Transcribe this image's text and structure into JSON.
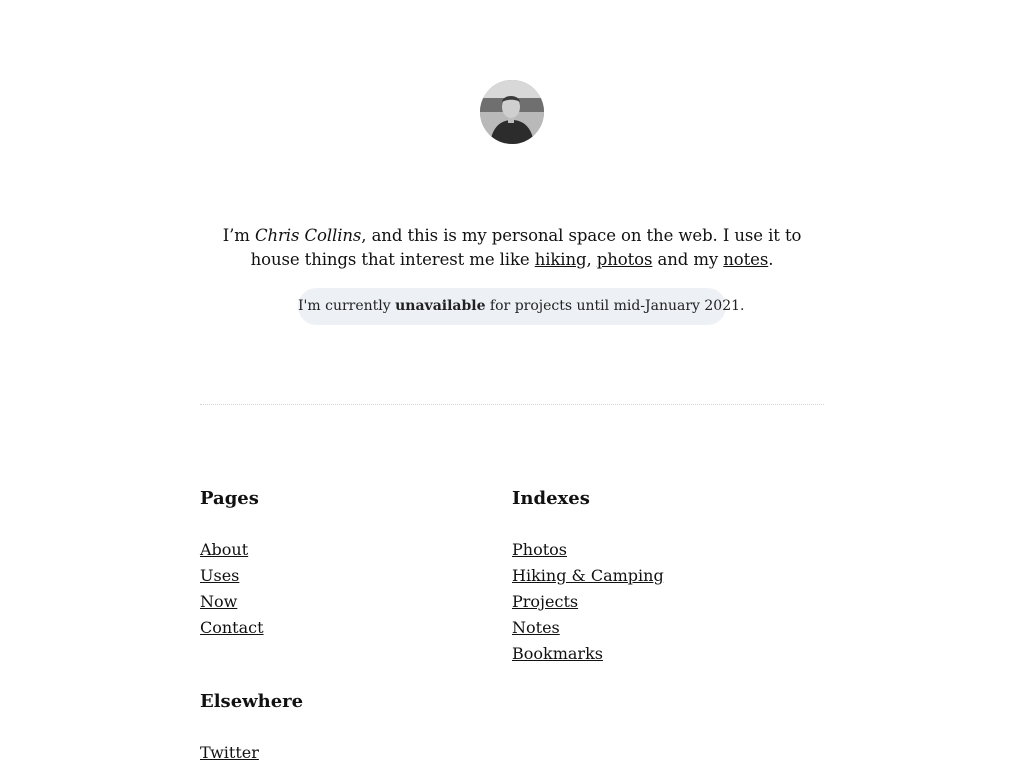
{
  "profile": {
    "avatar_icon": "profile-photo"
  },
  "intro": {
    "prefix": "I’m ",
    "name": "Chris Collins",
    "middle": ", and this is my personal space on the web. I use it to house things that interest me like ",
    "link_hiking": "hiking",
    "sep1": ", ",
    "link_photos": "photos",
    "sep2": " and my ",
    "link_notes": "notes",
    "suffix": "."
  },
  "status": {
    "prefix": "I'm currently ",
    "state": "unavailable",
    "suffix": " for projects until mid-January 2021."
  },
  "pages": {
    "heading": "Pages",
    "items": [
      "About",
      "Uses",
      "Now",
      "Contact"
    ]
  },
  "indexes": {
    "heading": "Indexes",
    "items": [
      "Photos",
      "Hiking & Camping",
      "Projects",
      "Notes",
      "Bookmarks"
    ]
  },
  "elsewhere": {
    "heading": "Elsewhere",
    "items": [
      "Twitter"
    ]
  }
}
